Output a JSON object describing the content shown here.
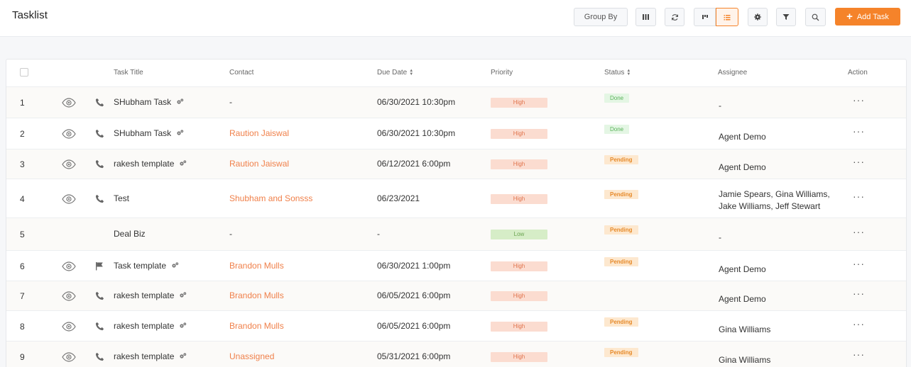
{
  "header": {
    "title": "Tasklist",
    "group_by_label": "Group By",
    "add_task_label": "Add Task"
  },
  "colors": {
    "accent": "#f5832a",
    "link": "#f0804a",
    "high_bg": "#fbdcd0",
    "low_bg": "#d6edc7",
    "done_bg": "#e4f6e4",
    "pending_bg": "#fde8cf"
  },
  "table": {
    "columns": {
      "title": "Task Title",
      "contact": "Contact",
      "due_date": "Due Date",
      "priority": "Priority",
      "status": "Status",
      "assignee": "Assignee",
      "action": "Action"
    },
    "action_label": "···",
    "rows": [
      {
        "num": "1",
        "eye": true,
        "type": "phone",
        "title": "SHubham Task",
        "cog": true,
        "contact": "-",
        "contact_link": false,
        "due": "06/30/2021 10:30pm",
        "priority": "High",
        "priority_level": "high",
        "status": "Done",
        "status_level": "done",
        "assignee": "-"
      },
      {
        "num": "2",
        "eye": true,
        "type": "phone",
        "title": "SHubham Task",
        "cog": true,
        "contact": "Raution Jaiswal",
        "contact_link": true,
        "due": "06/30/2021 10:30pm",
        "priority": "High",
        "priority_level": "high",
        "status": "Done",
        "status_level": "done",
        "assignee": "Agent Demo"
      },
      {
        "num": "3",
        "eye": true,
        "type": "phone",
        "title": "rakesh template",
        "cog": true,
        "contact": "Raution Jaiswal",
        "contact_link": true,
        "due": "06/12/2021 6:00pm",
        "priority": "High",
        "priority_level": "high",
        "status": "Pending",
        "status_level": "pending",
        "assignee": "Agent Demo"
      },
      {
        "num": "4",
        "eye": true,
        "type": "phone",
        "title": "Test",
        "cog": false,
        "contact": "Shubham and Sonsss",
        "contact_link": true,
        "due": "06/23/2021",
        "priority": "High",
        "priority_level": "high",
        "status": "Pending",
        "status_level": "pending",
        "assignee": "Jamie Spears, Gina Williams, Jake Williams, Jeff Stewart"
      },
      {
        "num": "5",
        "eye": false,
        "type": "none",
        "title": "Deal Biz",
        "cog": false,
        "contact": "-",
        "contact_link": false,
        "due": "-",
        "priority": "Low",
        "priority_level": "low",
        "status": "Pending",
        "status_level": "pending",
        "assignee": "-"
      },
      {
        "num": "6",
        "eye": true,
        "type": "flag",
        "title": "Task template",
        "cog": true,
        "contact": "Brandon Mulls",
        "contact_link": true,
        "due": "06/30/2021 1:00pm",
        "priority": "High",
        "priority_level": "high",
        "status": "Pending",
        "status_level": "pending",
        "assignee": "Agent Demo"
      },
      {
        "num": "7",
        "eye": true,
        "type": "phone",
        "title": "rakesh template",
        "cog": true,
        "contact": "Brandon Mulls",
        "contact_link": true,
        "due": "06/05/2021 6:00pm",
        "priority": "High",
        "priority_level": "high",
        "status": "",
        "status_level": "",
        "assignee": "Agent Demo"
      },
      {
        "num": "8",
        "eye": true,
        "type": "phone",
        "title": "rakesh template",
        "cog": true,
        "contact": "Brandon Mulls",
        "contact_link": true,
        "due": "06/05/2021 6:00pm",
        "priority": "High",
        "priority_level": "high",
        "status": "Pending",
        "status_level": "pending",
        "assignee": "Gina Williams"
      },
      {
        "num": "9",
        "eye": true,
        "type": "phone",
        "title": "rakesh template",
        "cog": true,
        "contact": "Unassigned",
        "contact_link": true,
        "due": "05/31/2021 6:00pm",
        "priority": "High",
        "priority_level": "high",
        "status": "Pending",
        "status_level": "pending",
        "assignee": "Gina Williams"
      }
    ]
  }
}
